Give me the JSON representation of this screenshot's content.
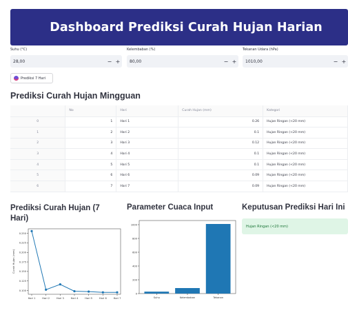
{
  "header": {
    "title": "Dashboard Prediksi Curah Hujan Harian"
  },
  "inputs": [
    {
      "label": "Suhu (°C)",
      "value": "28,00",
      "minus": "−",
      "plus": "+"
    },
    {
      "label": "Kelembaban (%)",
      "value": "80,00",
      "minus": "−",
      "plus": "+"
    },
    {
      "label": "Tekanan Udara (hPa)",
      "value": "1010,00",
      "minus": "−",
      "plus": "+"
    }
  ],
  "predict_button": {
    "label": "Prediksi 7 Hari",
    "icon": "rocket-icon"
  },
  "weekly": {
    "title": "Prediksi Curah Hujan Mingguan",
    "columns": [
      "",
      "No",
      "Hari",
      "Curah Hujan (mm)",
      "Kategori"
    ],
    "rows": [
      {
        "idx": "0",
        "no": "1",
        "hari": "Hari 1",
        "curah": "0.26",
        "kategori": "Hujan Ringan (<20 mm)"
      },
      {
        "idx": "1",
        "no": "2",
        "hari": "Hari 2",
        "curah": "0.1",
        "kategori": "Hujan Ringan (<20 mm)"
      },
      {
        "idx": "2",
        "no": "3",
        "hari": "Hari 3",
        "curah": "0.12",
        "kategori": "Hujan Ringan (<20 mm)"
      },
      {
        "idx": "3",
        "no": "4",
        "hari": "Hari 4",
        "curah": "0.1",
        "kategori": "Hujan Ringan (<20 mm)"
      },
      {
        "idx": "4",
        "no": "5",
        "hari": "Hari 5",
        "curah": "0.1",
        "kategori": "Hujan Ringan (<20 mm)"
      },
      {
        "idx": "5",
        "no": "6",
        "hari": "Hari 6",
        "curah": "0.09",
        "kategori": "Hujan Ringan (<20 mm)"
      },
      {
        "idx": "6",
        "no": "7",
        "hari": "Hari 7",
        "curah": "0.09",
        "kategori": "Hujan Ringan (<20 mm)"
      }
    ]
  },
  "sections": {
    "line_title_1": "Prediksi Curah Hujan (7",
    "line_title_2": "Hari)",
    "bar_title": "Parameter Cuaca Input",
    "decision_title": "Keputusan Prediksi Hari Ini",
    "decision_text": "Hujan Ringan (<20 mm)"
  },
  "chart_data": [
    {
      "type": "line",
      "x": [
        "Hari 1",
        "Hari 2",
        "Hari 3",
        "Hari 4",
        "Hari 5",
        "Hari 6",
        "Hari 7"
      ],
      "values": [
        0.256,
        0.102,
        0.116,
        0.098,
        0.097,
        0.095,
        0.095
      ],
      "ylabel": "Curah Hujan (mm)",
      "ylim": [
        0.09,
        0.262
      ],
      "yticks": [
        "0.100",
        "0.125",
        "0.150",
        "0.175",
        "0.200",
        "0.225",
        "0.250"
      ],
      "yticks_v": [
        0.1,
        0.125,
        0.15,
        0.175,
        0.2,
        0.225,
        0.25
      ],
      "color": "#1f77b4",
      "marker": "dot"
    },
    {
      "type": "bar",
      "categories": [
        "Suhu",
        "Kelembaban",
        "Tekanan"
      ],
      "values": [
        28,
        80,
        1010
      ],
      "ylim": [
        0,
        1060
      ],
      "yticks": [
        "0",
        "200",
        "400",
        "600",
        "800",
        "1000"
      ],
      "yticks_v": [
        0,
        200,
        400,
        600,
        800,
        1000
      ],
      "color": "#1f77b4"
    }
  ]
}
